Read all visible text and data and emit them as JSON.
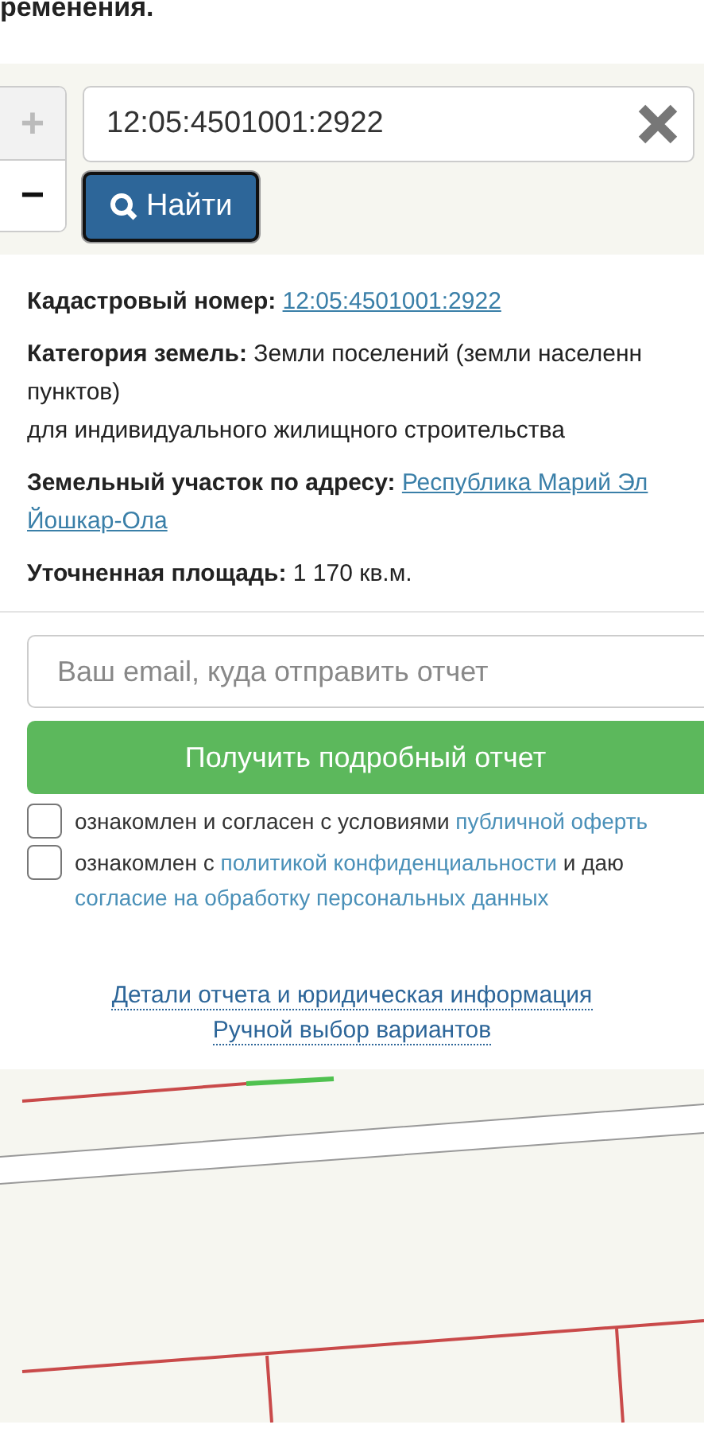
{
  "heading_fragment": "ременения.",
  "zoom_controls": [
    {
      "label": "+",
      "disabled": true
    },
    {
      "label": "−",
      "disabled": false
    }
  ],
  "search": {
    "value": "12:05:4501001:2922",
    "button": "Найти"
  },
  "details": [
    {
      "label": "Кадастровый номер:",
      "lines": [
        {
          "text": "12:05:4501001:2922",
          "link": true
        }
      ]
    },
    {
      "label": "Категория земель:",
      "lines": [
        {
          "text": "Земли поселений (земли населенн",
          "link": false
        },
        {
          "text": "пунктов)",
          "link": false
        },
        {
          "text": "для индивидуального жилищного строительства",
          "link": false
        }
      ]
    },
    {
      "label": "Земельный участок по адресу:",
      "lines": [
        {
          "text": "Республика Марий Эл",
          "link": true
        },
        {
          "text": "Йошкар-Ола",
          "link": true
        }
      ]
    },
    {
      "label": "Уточненная площадь:",
      "lines": [
        {
          "text": "1 170 кв.м.",
          "link": false
        }
      ]
    }
  ],
  "email": {
    "placeholder": "Ваш email, куда отправить отчет"
  },
  "submit": "Получить подробный отчет",
  "agreements": [
    {
      "checked": false,
      "parts": [
        {
          "text": "ознакомлен и согласен с условиями",
          "link": false
        },
        {
          "text": "публичной оферть",
          "link": true
        }
      ]
    },
    {
      "checked": false,
      "parts": [
        {
          "text": "ознакомлен с",
          "link": false
        },
        {
          "text": "политикой конфиденциальности",
          "link": true
        },
        {
          "text": "и даю",
          "link": false
        },
        {
          "text": "согласие на обработку персональных данных",
          "link": true
        }
      ]
    }
  ],
  "footer_links": [
    "Детали отчета и юридическая информация",
    "Ручной выбор вариантов"
  ],
  "map": {
    "kind": "picture"
  }
}
